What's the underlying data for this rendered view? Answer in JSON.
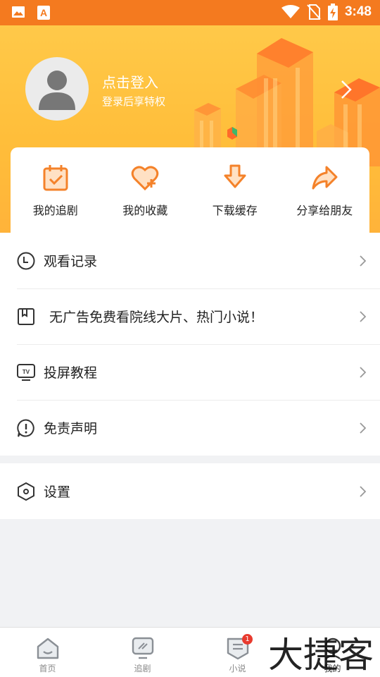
{
  "status_bar": {
    "time": "3:48",
    "left_icons": [
      "image-icon",
      "app-a-icon"
    ],
    "right_icons": [
      "wifi-icon",
      "no-sim-icon",
      "battery-charging-icon"
    ]
  },
  "profile": {
    "login_title": "点击登入",
    "login_subtitle": "登录后享特权"
  },
  "quick_actions": [
    {
      "label": "我的追剧",
      "icon": "calendar-check-icon"
    },
    {
      "label": "我的收藏",
      "icon": "heart-plus-icon"
    },
    {
      "label": "下载缓存",
      "icon": "download-icon"
    },
    {
      "label": "分享给朋友",
      "icon": "share-arrow-icon"
    }
  ],
  "menu": [
    {
      "label": "观看记录",
      "icon": "clock-icon"
    },
    {
      "label": "无广告免费看院线大片、热门小说！",
      "icon": "book-icon"
    },
    {
      "label": "投屏教程",
      "icon": "tv-icon"
    },
    {
      "label": "免责声明",
      "icon": "exclamation-icon"
    }
  ],
  "settings": {
    "label": "设置",
    "icon": "hexagon-gear-icon"
  },
  "tabbar": [
    {
      "label": "首页",
      "icon": "home-icon"
    },
    {
      "label": "追剧",
      "icon": "monitor-icon"
    },
    {
      "label": "小说",
      "icon": "novel-icon",
      "badge": "1"
    },
    {
      "label": "我的",
      "icon": "profile-icon"
    }
  ],
  "watermark": "大捷客",
  "colors": {
    "status_bar": "#f47a1f",
    "accent": "#f4822a",
    "header_gradient_top": "#ffc949",
    "header_gradient_bottom": "#ffb33a",
    "badge": "#e83a2e"
  }
}
